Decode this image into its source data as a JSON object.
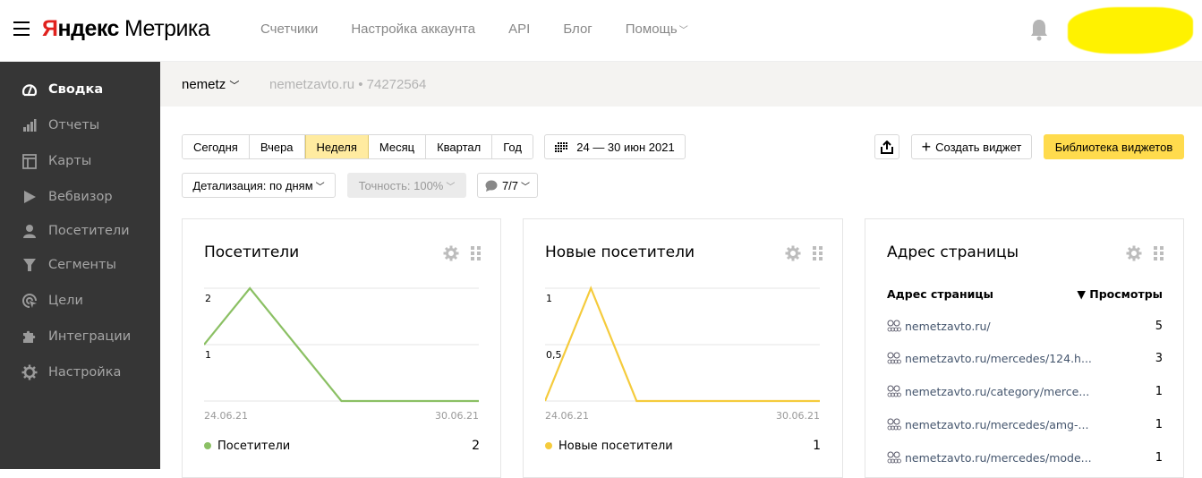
{
  "header": {
    "logo_ya": "Я",
    "logo_ndex": "ндекс",
    "logo_product": "Метрика",
    "nav": [
      "Счетчики",
      "Настройка аккаунта",
      "API",
      "Блог",
      "Помощь"
    ],
    "help_chevron": "﹀",
    "bell_icon": "bell-icon"
  },
  "sidebar": {
    "items": [
      {
        "label": "Сводка",
        "icon": "dashboard-gauge-icon",
        "active": true
      },
      {
        "label": "Отчеты",
        "icon": "bar-chart-icon"
      },
      {
        "label": "Карты",
        "icon": "map-layout-icon"
      },
      {
        "label": "Вебвизор",
        "icon": "play-icon"
      },
      {
        "label": "Посетители",
        "icon": "user-icon"
      },
      {
        "label": "Сегменты",
        "icon": "filter-icon"
      },
      {
        "label": "Цели",
        "icon": "target-cursor-icon"
      },
      {
        "label": "Интеграции",
        "icon": "puzzle-icon"
      },
      {
        "label": "Настройка",
        "icon": "gear-icon"
      }
    ]
  },
  "counter": {
    "name": "nemetz",
    "site": "nemetzavto.ru • 74272564"
  },
  "toolbar": {
    "periods": [
      "Сегодня",
      "Вчера",
      "Неделя",
      "Месяц",
      "Квартал",
      "Год"
    ],
    "active_period": "Неделя",
    "date_range": "24 — 30 июн 2021",
    "detail": "Детализация: по дням",
    "accuracy": "Точность: 100%",
    "segments": "7/7",
    "create_widget": "Создать виджет",
    "widget_library": "Библиотека виджетов"
  },
  "widgets": {
    "visitors": {
      "title": "Посетители",
      "legend": "Посетители",
      "total": "2",
      "color": "#8bc064"
    },
    "new_visitors": {
      "title": "Новые посетители",
      "legend": "Новые посетители",
      "total": "1",
      "color": "#f5cb3c"
    },
    "pages": {
      "title": "Адрес страницы",
      "col_page": "Адрес страницы",
      "col_views": "▼ Просмотры",
      "rows": [
        {
          "url": "nemetzavto.ru/",
          "views": "5"
        },
        {
          "url": "nemetzavto.ru/mercedes/124.h...",
          "views": "3"
        },
        {
          "url": "nemetzavto.ru/category/merce...",
          "views": "1"
        },
        {
          "url": "nemetzavto.ru/mercedes/amg-...",
          "views": "1"
        },
        {
          "url": "nemetzavto.ru/mercedes/mode...",
          "views": "1"
        }
      ]
    }
  },
  "chart_data": [
    {
      "type": "line",
      "title": "Посетители",
      "x": [
        "24.06.21",
        "25.06.21",
        "26.06.21",
        "27.06.21",
        "28.06.21",
        "29.06.21",
        "30.06.21"
      ],
      "series": [
        {
          "name": "Посетители",
          "values": [
            1,
            2,
            1,
            0,
            0,
            0,
            0
          ],
          "color": "#8bc064"
        }
      ],
      "x_tick_labels": [
        "24.06.21",
        "30.06.21"
      ],
      "y_tick_labels": [
        "2",
        "1"
      ],
      "ylim": [
        0,
        2
      ],
      "grid": true,
      "legend": "bottom"
    },
    {
      "type": "line",
      "title": "Новые посетители",
      "x": [
        "24.06.21",
        "25.06.21",
        "26.06.21",
        "27.06.21",
        "28.06.21",
        "29.06.21",
        "30.06.21"
      ],
      "series": [
        {
          "name": "Новые посетители",
          "values": [
            0,
            1,
            0,
            0,
            0,
            0,
            0
          ],
          "color": "#f5cb3c"
        }
      ],
      "x_tick_labels": [
        "24.06.21",
        "30.06.21"
      ],
      "y_tick_labels": [
        "1",
        "0,5"
      ],
      "ylim": [
        0,
        1
      ],
      "grid": true,
      "legend": "bottom"
    }
  ]
}
